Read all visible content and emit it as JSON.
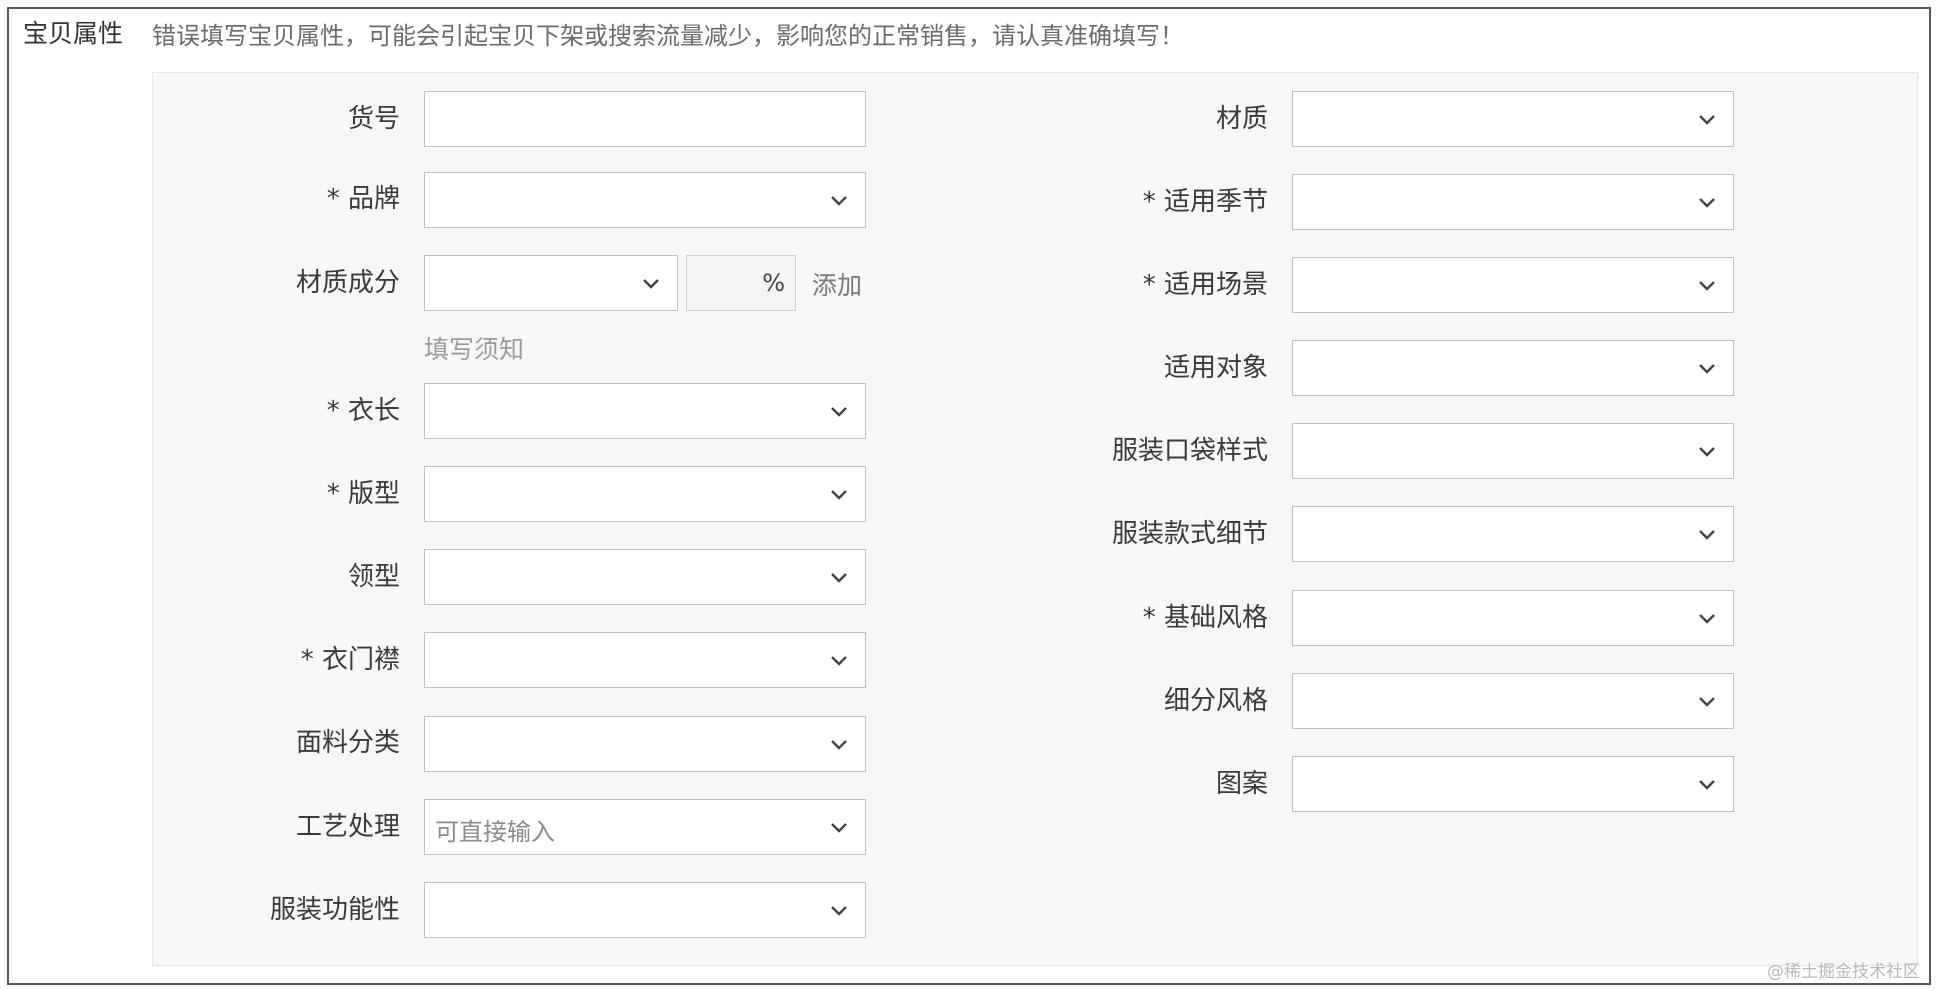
{
  "section": {
    "title": "宝贝属性",
    "warning": "错误填写宝贝属性，可能会引起宝贝下架或搜索流量减少，影响您的正常销售，请认真准确填写！"
  },
  "left_fields": [
    {
      "label": "货号",
      "kind": "text",
      "value": ""
    },
    {
      "label": "* 品牌",
      "kind": "select",
      "value": ""
    },
    {
      "label": "材质成分",
      "kind": "composite",
      "value": ""
    },
    {
      "label": "* 衣长",
      "kind": "select",
      "value": ""
    },
    {
      "label": "* 版型",
      "kind": "select",
      "value": ""
    },
    {
      "label": "领型",
      "kind": "select",
      "value": ""
    },
    {
      "label": "* 衣门襟",
      "kind": "select",
      "value": ""
    },
    {
      "label": "面料分类",
      "kind": "select",
      "value": ""
    },
    {
      "label": "工艺处理",
      "kind": "select",
      "value": "",
      "placeholder": "可直接输入"
    },
    {
      "label": "服装功能性",
      "kind": "select",
      "value": ""
    }
  ],
  "material": {
    "percent_symbol": "%",
    "add_label": "添加",
    "hint": "填写须知"
  },
  "right_fields": [
    {
      "label": "材质",
      "kind": "select",
      "value": ""
    },
    {
      "label": "* 适用季节",
      "kind": "select",
      "value": ""
    },
    {
      "label": "* 适用场景",
      "kind": "select",
      "value": ""
    },
    {
      "label": "适用对象",
      "kind": "select",
      "value": ""
    },
    {
      "label": "服装口袋样式",
      "kind": "select",
      "value": ""
    },
    {
      "label": "服装款式细节",
      "kind": "select",
      "value": ""
    },
    {
      "label": "* 基础风格",
      "kind": "select",
      "value": ""
    },
    {
      "label": "细分风格",
      "kind": "select",
      "value": ""
    },
    {
      "label": "图案",
      "kind": "select",
      "value": ""
    }
  ],
  "watermark": "@稀土掘金技术社区",
  "icons": {
    "dropdown": "chevron-down-icon"
  }
}
